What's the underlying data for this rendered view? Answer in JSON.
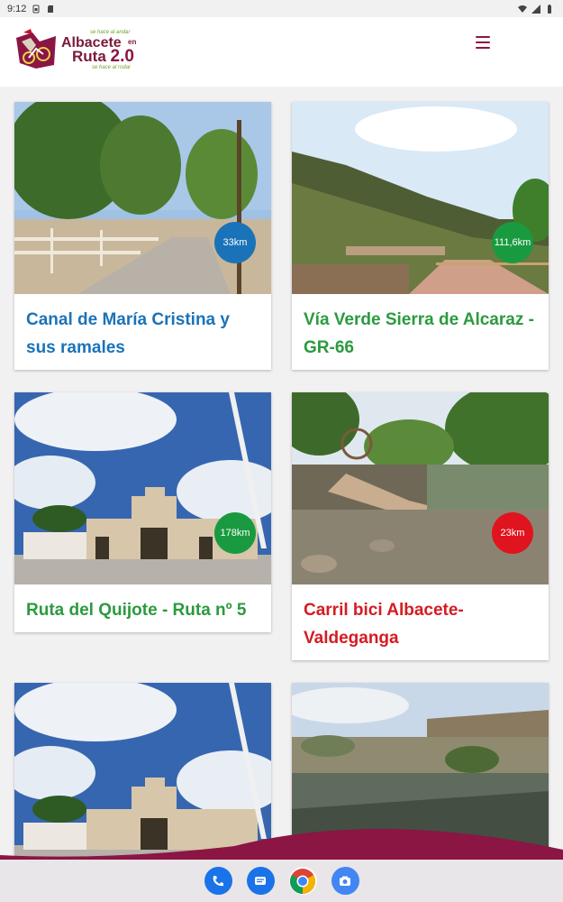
{
  "status_bar": {
    "time": "9:12"
  },
  "header": {
    "logo": {
      "tagline_top": "se hace al andar",
      "brand_line1": "Albacete",
      "brand_en": "en",
      "brand_line2": "Ruta",
      "brand_version": "2.0",
      "tagline_bottom": "se hace al rodar"
    },
    "menu_icon": "hamburger-icon"
  },
  "colors": {
    "brand": "#8b1543",
    "blue": "#1a73b9",
    "green": "#2b9a3f",
    "red": "#d41c22"
  },
  "routes": [
    {
      "title": "Canal de María Cristina y sus ramales",
      "distance": "33km",
      "color": "blue"
    },
    {
      "title": "Vía Verde Sierra de Alcaraz -GR-66",
      "distance": "111,6km",
      "color": "green"
    },
    {
      "title": "Ruta del Quijote - Ruta nº 5",
      "distance": "178km",
      "color": "green"
    },
    {
      "title": "Carril bici Albacete-Valdeganga",
      "distance": "23km",
      "color": "red"
    },
    {
      "title": "",
      "distance": "",
      "color": ""
    },
    {
      "title": "",
      "distance": "",
      "color": ""
    }
  ],
  "dock": [
    "phone-icon",
    "messages-icon",
    "chrome-icon",
    "camera-icon"
  ]
}
